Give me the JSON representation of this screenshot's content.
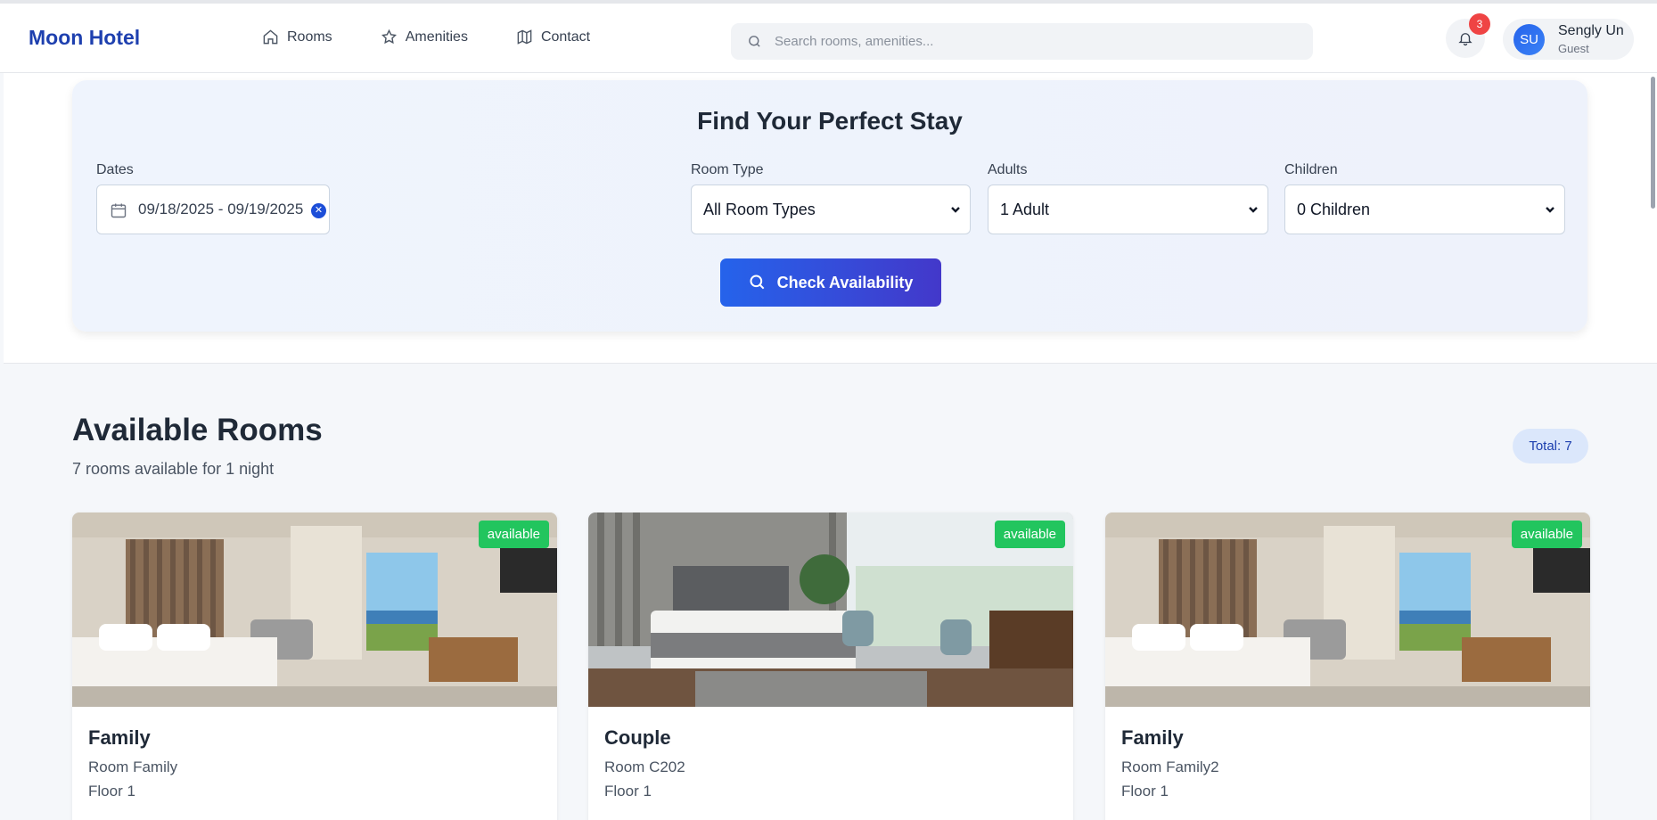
{
  "header": {
    "brand": "Moon Hotel",
    "nav": [
      {
        "label": "Rooms",
        "icon": "home-icon"
      },
      {
        "label": "Amenities",
        "icon": "star-icon"
      },
      {
        "label": "Contact",
        "icon": "map-icon"
      }
    ],
    "search_placeholder": "Search rooms, amenities...",
    "notifications_count": "3",
    "user": {
      "initials": "SU",
      "name": "Sengly Un",
      "role": "Guest"
    }
  },
  "search_panel": {
    "title": "Find Your Perfect Stay",
    "dates_label": "Dates",
    "dates_value": "09/18/2025 - 09/19/2025",
    "room_type_label": "Room Type",
    "room_type_value": "All Room Types",
    "adults_label": "Adults",
    "adults_value": "1 Adult",
    "children_label": "Children",
    "children_value": "0 Children",
    "check_button": "Check Availability"
  },
  "rooms_section": {
    "title": "Available Rooms",
    "subtitle": "7 rooms available for 1 night",
    "total": "Total: 7",
    "rooms": [
      {
        "name": "Family",
        "room": "Room Family",
        "floor": "Floor 1",
        "status": "available"
      },
      {
        "name": "Couple",
        "room": "Room C202",
        "floor": "Floor 1",
        "status": "available"
      },
      {
        "name": "Family",
        "room": "Room Family2",
        "floor": "Floor 1",
        "status": "available"
      }
    ]
  },
  "colors": {
    "brand": "#1e40af",
    "primary_button": "#2563eb",
    "available_badge": "#22c55e",
    "notification_badge": "#ef4444"
  }
}
